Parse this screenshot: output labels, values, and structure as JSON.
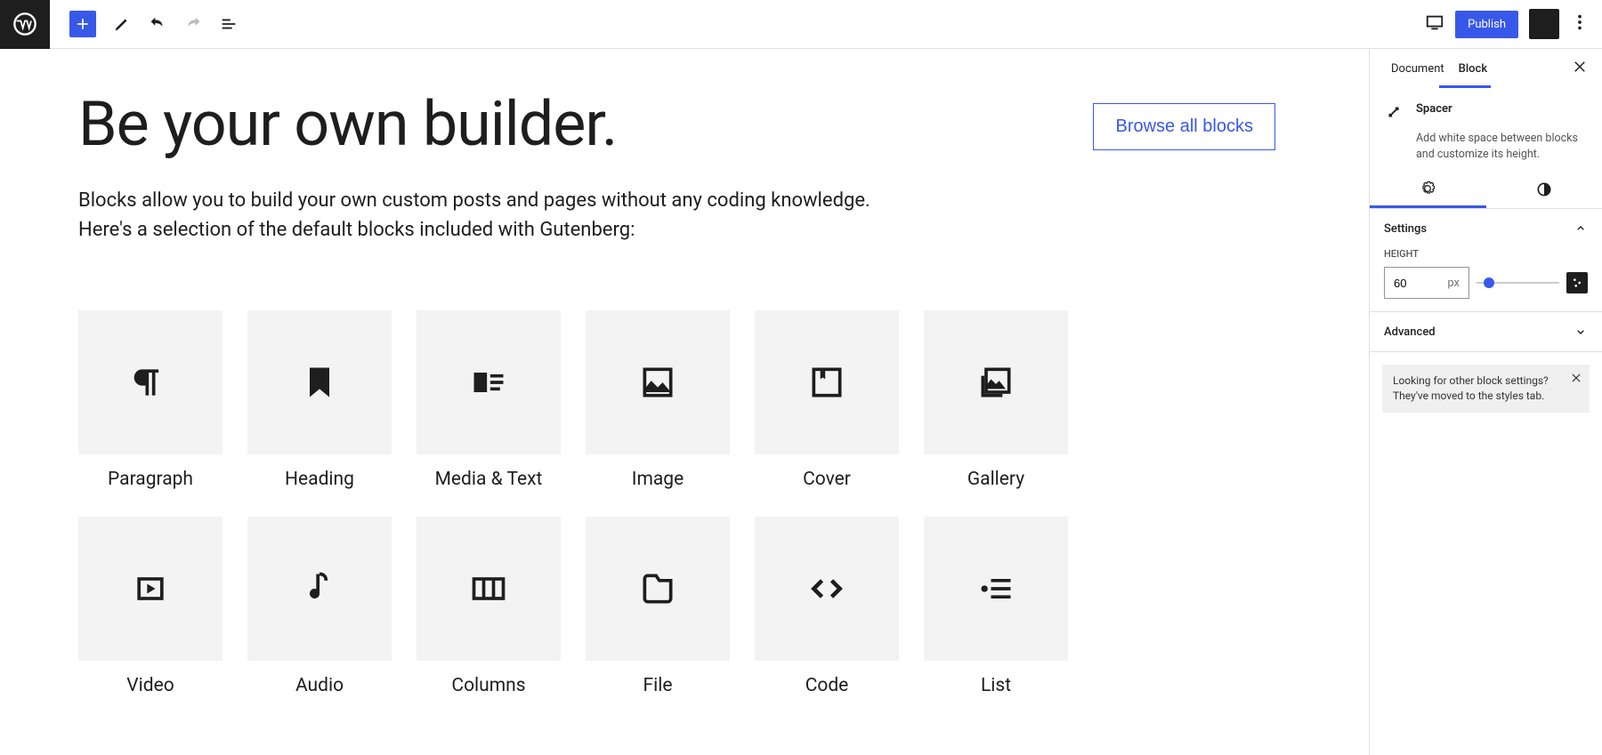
{
  "toolbar": {
    "publish": "Publish"
  },
  "content": {
    "title": "Be your own builder.",
    "browse": "Browse all blocks",
    "paragraph1": "Blocks allow you to build your own custom posts and pages without any coding knowledge.",
    "paragraph2": "Here's a selection of the default blocks included with Gutenberg:",
    "blocks": [
      {
        "label": "Paragraph",
        "icon": "paragraph"
      },
      {
        "label": "Heading",
        "icon": "heading"
      },
      {
        "label": "Media & Text",
        "icon": "media-text"
      },
      {
        "label": "Image",
        "icon": "image"
      },
      {
        "label": "Cover",
        "icon": "cover"
      },
      {
        "label": "Gallery",
        "icon": "gallery"
      },
      {
        "label": "Video",
        "icon": "video"
      },
      {
        "label": "Audio",
        "icon": "audio"
      },
      {
        "label": "Columns",
        "icon": "columns"
      },
      {
        "label": "File",
        "icon": "file"
      },
      {
        "label": "Code",
        "icon": "code"
      },
      {
        "label": "List",
        "icon": "list"
      }
    ]
  },
  "sidebar": {
    "tabs": {
      "doc": "Document",
      "block": "Block"
    },
    "block_name": "Spacer",
    "block_desc": "Add white space between blocks and customize its height.",
    "settings_label": "Settings",
    "height_label": "HEIGHT",
    "height_value": "60",
    "height_unit": "px",
    "advanced_label": "Advanced",
    "notice": "Looking for other block settings? They've moved to the styles tab."
  }
}
